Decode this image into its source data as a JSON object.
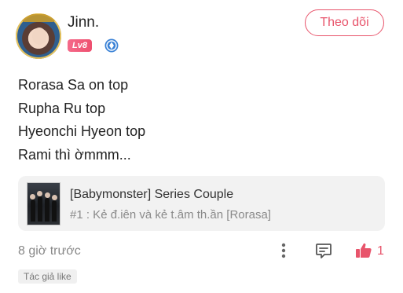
{
  "header": {
    "username": "Jinn.",
    "level": "Lv8",
    "follow_label": "Theo dõi"
  },
  "post": {
    "lines": [
      "Rorasa Sa on top",
      "Rupha Ru top",
      "Hyeonchi Hyeon top",
      "Rami thì ờmmm..."
    ]
  },
  "link_card": {
    "title": "[Babymonster] Series Couple",
    "subtitle": "#1 : Kẻ đ.iên và kẻ t.âm th.ần [Rorasa]"
  },
  "footer": {
    "timestamp": "8 giờ trước",
    "like_count": "1",
    "author_tag": "Tác giả like"
  },
  "icons": {
    "verified": "verified-badge-icon",
    "more": "more-vertical-icon",
    "comment": "comment-icon",
    "like": "thumbs-up-icon"
  },
  "colors": {
    "accent": "#e8546b",
    "level_badge": "#ee4f6f",
    "verified": "#3b82d6",
    "card_bg": "#f2f2f2",
    "muted_text": "#888888"
  }
}
